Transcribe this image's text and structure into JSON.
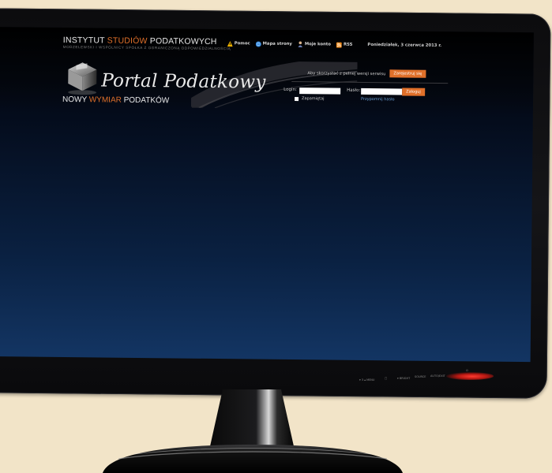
{
  "site": {
    "brand_top_a": "INSTYTUT ",
    "brand_top_b": "STUDIÓW",
    "brand_top_c": " PODATKOWYCH",
    "brand_sub": "MODZELEWSKI I WSPÓLNICY SPÓŁKA Z OGRANICZONĄ ODPOWIEDZIALNOŚCIĄ",
    "portal_title": "Portal Podatkowy",
    "tagline_a": "NOWY ",
    "tagline_b": "WYMIAR",
    "tagline_c": " PODATKÓW",
    "accent_color": "#e0702a"
  },
  "topnav": {
    "items": [
      {
        "label": "Pomoc",
        "icon": "warning-icon"
      },
      {
        "label": "Mapa strony",
        "icon": "globe-icon"
      },
      {
        "label": "Moje konto",
        "icon": "user-icon"
      },
      {
        "label": "RSS",
        "icon": "rss-icon"
      }
    ],
    "date": "Poniedziałek, 3 czerwca 2013 r."
  },
  "login": {
    "prompt": "Aby skorzystać z pełnej wersji serwisu",
    "register_label": "Zarejestruj się",
    "login_label": "Login:",
    "password_label": "Hasło:",
    "login_value": "",
    "password_value": "",
    "submit_label": "Zaloguj",
    "remember_label": "Zapamiętaj",
    "forgot_label": "Przypomnij hasło"
  },
  "monitor": {
    "chin_labels": [
      "▾ 3 ▴ MENU",
      "□",
      "▾ BRIGHT",
      "SOURCE",
      "AUTO/EXIT",
      "⏻"
    ]
  }
}
